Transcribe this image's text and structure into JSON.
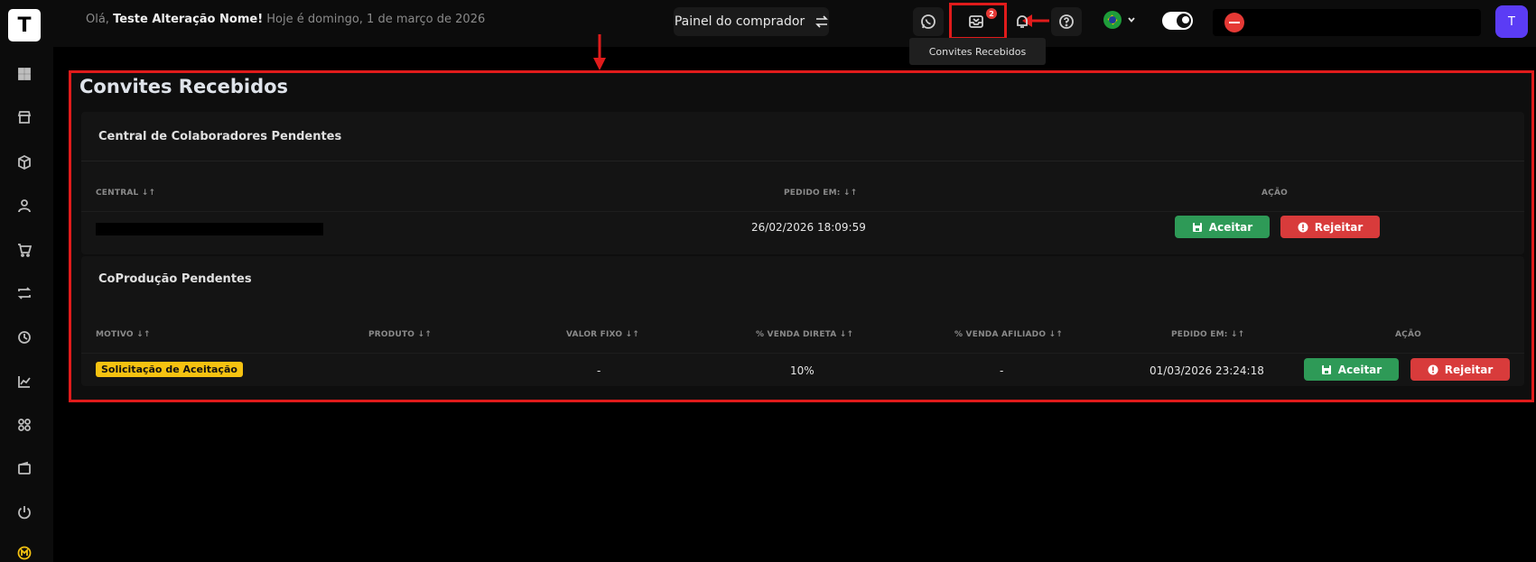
{
  "sidebar": {
    "logo": "T",
    "icons": [
      "dashboard-icon",
      "store-icon",
      "box-icon",
      "users-icon",
      "cart-icon",
      "repeat-icon",
      "history-icon",
      "chart-line-icon",
      "apps-icon",
      "wallet-icon",
      "power-icon",
      "m-coin-icon"
    ]
  },
  "header": {
    "greeting_prefix": "Olá,",
    "user_name": "Teste Alteração Nome!",
    "date_text": "Hoje é domingo, 1 de março de 2026",
    "buyer_panel_label": "Painel do comprador",
    "inbox_badge": "2",
    "tooltip": "Convites Recebidos",
    "avatar_letter": "T"
  },
  "page": {
    "title": "Convites Recebidos"
  },
  "collaborators": {
    "title": "Central de Colaboradores Pendentes",
    "columns": [
      "CENTRAL ↓↑",
      "PEDIDO EM: ↓↑",
      "AÇÃO"
    ],
    "rows": [
      {
        "central": "",
        "requested_at": "26/02/2026 18:09:59",
        "accept": "Aceitar",
        "reject": "Rejeitar"
      }
    ]
  },
  "coproduction": {
    "title": "CoProdução Pendentes",
    "columns": [
      "MOTIVO ↓↑",
      "PRODUTO ↓↑",
      "VALOR FIXO ↓↑",
      "% VENDA DIRETA ↓↑",
      "% VENDA AFILIADO ↓↑",
      "PEDIDO EM: ↓↑",
      "AÇÃO"
    ],
    "rows": [
      {
        "reason": "Solicitação de Aceitação",
        "product": "",
        "fixed_value": "-",
        "direct_sale": "10%",
        "affiliate_sale": "-",
        "requested_at": "01/03/2026 23:24:18",
        "accept": "Aceitar",
        "reject": "Rejeitar"
      }
    ]
  },
  "colors": {
    "accept": "#2e9a57",
    "reject": "#d83b3b",
    "pill": "#f5c211",
    "highlight": "#e01b1b",
    "avatar": "#5b3cf5"
  }
}
